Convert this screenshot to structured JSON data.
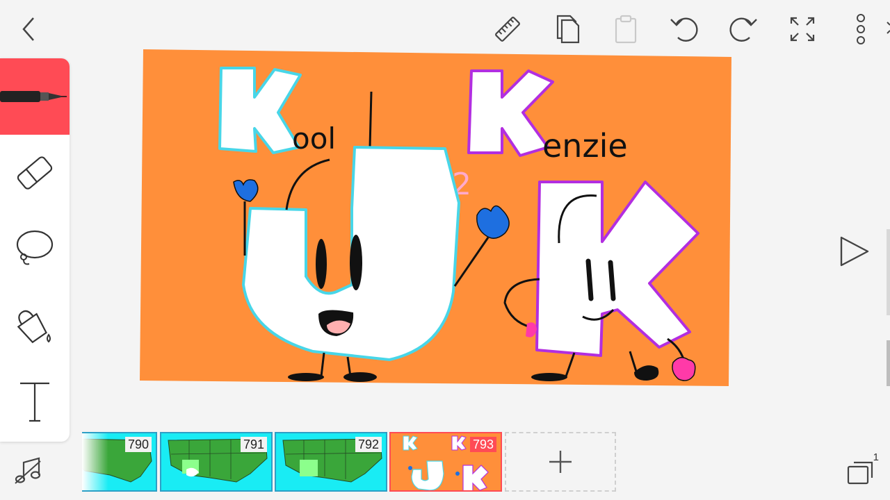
{
  "toolbar": {
    "back_icon": "chevron-left-icon",
    "ruler_icon": "ruler-icon",
    "copy_icon": "copy-icon",
    "paste_icon": "paste-icon",
    "undo_icon": "undo-icon",
    "redo_icon": "redo-icon",
    "fullscreen_icon": "expand-icon",
    "more_icon": "more-vertical-icon"
  },
  "tools": [
    {
      "name": "pen",
      "icon": "pen-icon",
      "active": true
    },
    {
      "name": "eraser",
      "icon": "eraser-icon"
    },
    {
      "name": "lasso",
      "icon": "lasso-icon"
    },
    {
      "name": "fill",
      "icon": "paint-bucket-icon"
    },
    {
      "name": "text",
      "icon": "text-icon"
    }
  ],
  "canvas": {
    "background": "#ff8f3a",
    "text_kool_rest": "ool",
    "text_kenzie_rest": "enzie",
    "text_two": "2"
  },
  "frames": [
    {
      "number": "790"
    },
    {
      "number": "791"
    },
    {
      "number": "792"
    },
    {
      "number": "793",
      "active": true
    }
  ],
  "colors": {
    "accent": "#ff4b55",
    "frame_border": "#2d9fc6",
    "cyan_outline": "#48d6e8",
    "purple_outline": "#b22ee0"
  },
  "layers_count": "1"
}
